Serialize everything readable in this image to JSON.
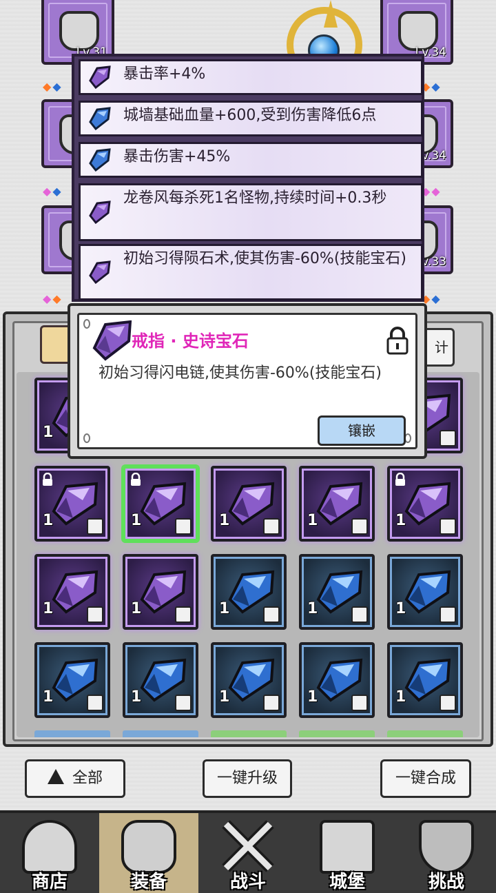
{
  "equipment": {
    "left_levels": [
      "Lv.31"
    ],
    "right_levels": [
      "Lv.34",
      "Lv.34",
      "Lv.33"
    ]
  },
  "gem_effects": [
    {
      "text": "暴击率+4%",
      "color": "purple"
    },
    {
      "text": "城墙基础血量+600,受到伤害降低6点",
      "color": "blue"
    },
    {
      "text": "暴击伤害+45%",
      "color": "blue"
    },
    {
      "text": "龙卷风每杀死1名怪物,持续时间+0.3秒",
      "color": "purple"
    },
    {
      "text": "初始习得陨石术,使其伤害-60%(技能宝石)",
      "color": "purple"
    }
  ],
  "detail": {
    "title": "戒指 · 史诗宝石",
    "description": "初始习得闪电链,使其伤害-60%(技能宝石)",
    "inlay_label": "镶嵌",
    "locked": true
  },
  "sort_label": "计",
  "grid": [
    {
      "type": "epic",
      "count": "1",
      "locked": true,
      "selected": false,
      "slot": "weapon-icon"
    },
    {
      "type": "epic",
      "count": "1",
      "locked": true,
      "selected": true,
      "slot": "ring-icon"
    },
    {
      "type": "epic",
      "count": "1",
      "locked": false,
      "selected": false,
      "slot": "ring-icon"
    },
    {
      "type": "epic",
      "count": "1",
      "locked": false,
      "selected": false,
      "slot": "ring-icon"
    },
    {
      "type": "epic",
      "count": "1",
      "locked": true,
      "selected": false,
      "slot": "ring-icon"
    },
    {
      "type": "epic",
      "count": "1",
      "locked": false,
      "selected": false,
      "slot": "necklace-icon"
    },
    {
      "type": "epic",
      "count": "1",
      "locked": false,
      "selected": false,
      "slot": "necklace-icon"
    },
    {
      "type": "rare",
      "count": "1",
      "locked": false,
      "selected": false,
      "slot": "necklace-icon"
    },
    {
      "type": "rare",
      "count": "1",
      "locked": false,
      "selected": false,
      "slot": "necklace-icon"
    },
    {
      "type": "rare",
      "count": "1",
      "locked": false,
      "selected": false,
      "slot": "armor-icon"
    },
    {
      "type": "rare",
      "count": "1",
      "locked": false,
      "selected": false,
      "slot": "armor-icon"
    },
    {
      "type": "rare",
      "count": "1",
      "locked": false,
      "selected": false,
      "slot": "armor-icon"
    },
    {
      "type": "rare",
      "count": "1",
      "locked": false,
      "selected": false,
      "slot": "boots-icon"
    },
    {
      "type": "rare",
      "count": "1",
      "locked": false,
      "selected": false,
      "slot": "weapon-icon"
    },
    {
      "type": "rare",
      "count": "1",
      "locked": false,
      "selected": false,
      "slot": "weapon-icon"
    }
  ],
  "top_row_partial": [
    {
      "type": "epic",
      "count": "1"
    },
    {
      "type": "epic",
      "count": "1",
      "slot": "weapon-icon"
    }
  ],
  "actions": {
    "all": "全部",
    "upgrade_all": "一键升级",
    "merge_all": "一键合成"
  },
  "nav": [
    {
      "label": "商店",
      "icon": "shop-icon",
      "active": false
    },
    {
      "label": "装备",
      "icon": "backpack-icon",
      "active": true
    },
    {
      "label": "战斗",
      "icon": "swords-icon",
      "active": false
    },
    {
      "label": "城堡",
      "icon": "castle-icon",
      "active": false
    },
    {
      "label": "挑战",
      "icon": "shield-icon",
      "active": false
    }
  ],
  "colors": {
    "epic": "#9f78cf",
    "rare": "#2b6fd4",
    "title_pink": "#e026b8",
    "inlay_blue": "#b8d8f5",
    "selected_green": "#5fe05a"
  }
}
